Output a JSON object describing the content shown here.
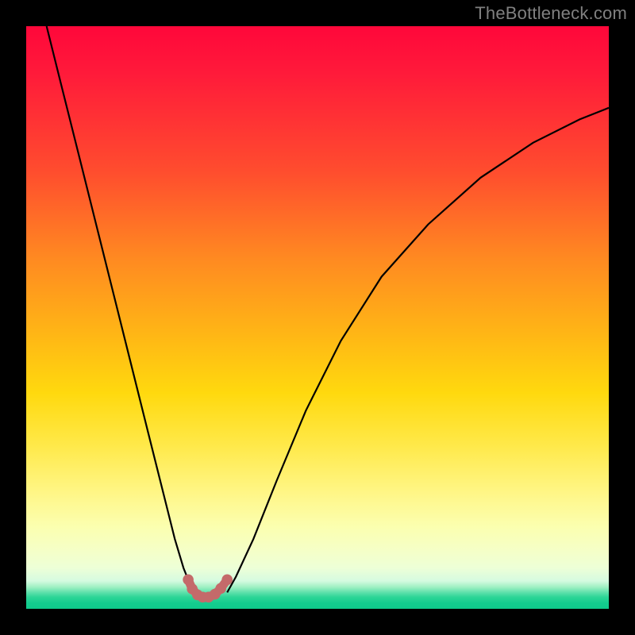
{
  "watermark": "TheBottleneck.com",
  "chart_data": {
    "type": "line",
    "title": "",
    "xlabel": "",
    "ylabel": "",
    "xlim": [
      0,
      1
    ],
    "ylim": [
      0,
      1
    ],
    "gradient_stops": [
      {
        "pos": 0.0,
        "color": "#ff073a"
      },
      {
        "pos": 0.25,
        "color": "#ff4d2e"
      },
      {
        "pos": 0.52,
        "color": "#ffb316"
      },
      {
        "pos": 0.72,
        "color": "#ffe94a"
      },
      {
        "pos": 0.9,
        "color": "#f5ffc7"
      },
      {
        "pos": 0.97,
        "color": "#5ee0ab"
      },
      {
        "pos": 1.0,
        "color": "#0fca8b"
      }
    ],
    "series": [
      {
        "name": "left-branch",
        "x": [
          0.035,
          0.06,
          0.09,
          0.12,
          0.15,
          0.18,
          0.21,
          0.235,
          0.255,
          0.27,
          0.282,
          0.29
        ],
        "y": [
          1.0,
          0.9,
          0.78,
          0.66,
          0.54,
          0.42,
          0.3,
          0.2,
          0.12,
          0.07,
          0.04,
          0.028
        ]
      },
      {
        "name": "right-branch",
        "x": [
          0.345,
          0.36,
          0.39,
          0.43,
          0.48,
          0.54,
          0.61,
          0.69,
          0.78,
          0.87,
          0.95,
          1.0
        ],
        "y": [
          0.028,
          0.055,
          0.12,
          0.22,
          0.34,
          0.46,
          0.57,
          0.66,
          0.74,
          0.8,
          0.84,
          0.86
        ]
      },
      {
        "name": "valley-marker",
        "style": "dotted-thick",
        "color": "#c46a6a",
        "x": [
          0.278,
          0.285,
          0.294,
          0.303,
          0.313,
          0.324,
          0.334,
          0.345
        ],
        "y": [
          0.05,
          0.034,
          0.024,
          0.02,
          0.02,
          0.025,
          0.035,
          0.05
        ]
      }
    ],
    "annotations": []
  }
}
